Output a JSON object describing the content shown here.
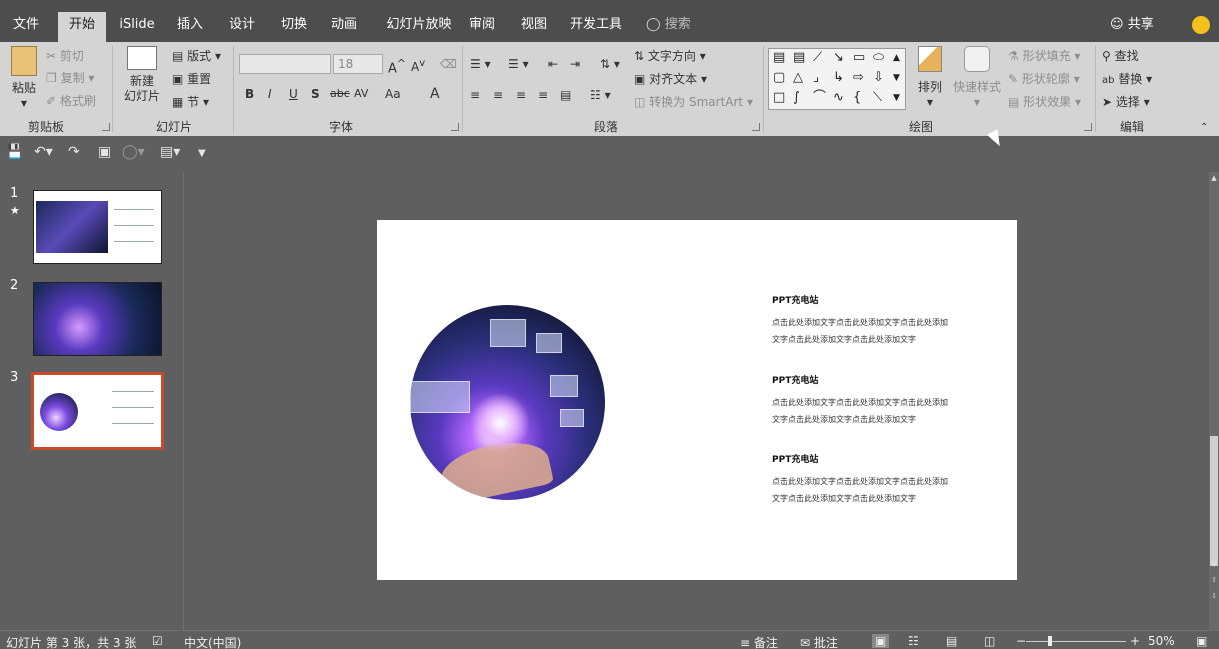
{
  "tabs": [
    "文件",
    "开始",
    "iSlide",
    "插入",
    "设计",
    "切换",
    "动画",
    "幻灯片放映",
    "审阅",
    "视图",
    "开发工具"
  ],
  "tell_me": "搜索",
  "share": "共享",
  "clipboard": {
    "paste": "粘贴",
    "cut": "剪切",
    "copy": "复制",
    "format_painter": "格式刷",
    "label": "剪贴板"
  },
  "slides_group": {
    "new_slide": "新建",
    "new_slide_2": "幻灯片",
    "layout": "版式",
    "reset": "重置",
    "section": "节",
    "label": "幻灯片"
  },
  "font_group": {
    "font_size": "18",
    "label": "字体",
    "bold": "B",
    "italic": "I",
    "underline": "U",
    "shadow": "S",
    "strike": "abc",
    "spacing": "AV",
    "case": "Aa",
    "color": "A"
  },
  "paragraph_group": {
    "text_direction": "文字方向",
    "align_text": "对齐文本",
    "smartart": "转换为 SmartArt",
    "label": "段落"
  },
  "drawing_group": {
    "arrange": "排列",
    "quick_styles": "快速样式",
    "shape_fill": "形状填充",
    "shape_outline": "形状轮廓",
    "shape_effects": "形状效果",
    "label": "绘图"
  },
  "editing_group": {
    "find": "查找",
    "replace": "替换",
    "select": "选择",
    "label": "编辑"
  },
  "thumbnails": [
    {
      "num": "1",
      "star": "★"
    },
    {
      "num": "2",
      "star": ""
    },
    {
      "num": "3",
      "star": ""
    }
  ],
  "slide": {
    "blocks": [
      {
        "title": "PPT充电站",
        "line1": "点击此处添加文字点击此处添加文字点击此处添加",
        "line2": "文字点击此处添加文字点击此处添加文字"
      },
      {
        "title": "PPT充电站",
        "line1": "点击此处添加文字点击此处添加文字点击此处添加",
        "line2": "文字点击此处添加文字点击此处添加文字"
      },
      {
        "title": "PPT充电站",
        "line1": "点击此处添加文字点击此处添加文字点击此处添加",
        "line2": "文字点击此处添加文字点击此处添加文字"
      }
    ]
  },
  "status": {
    "slide_info": "幻灯片 第 3 张，共 3 张",
    "language": "中文(中国)",
    "notes": "备注",
    "comments": "批注",
    "zoom": "50%"
  }
}
